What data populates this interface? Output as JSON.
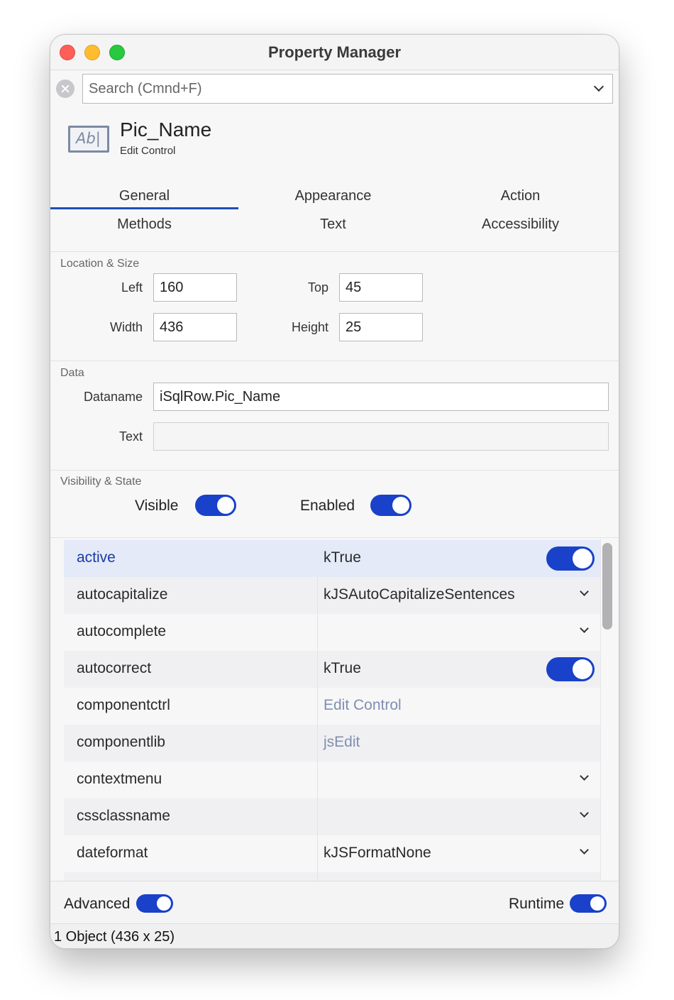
{
  "window": {
    "title": "Property Manager"
  },
  "search": {
    "placeholder": "Search (Cmnd+F)"
  },
  "object": {
    "name": "Pic_Name",
    "type": "Edit Control",
    "icon_text": "Ab|"
  },
  "tabs": [
    {
      "label": "General",
      "selected": true
    },
    {
      "label": "Appearance"
    },
    {
      "label": "Action"
    },
    {
      "label": "Methods"
    },
    {
      "label": "Text"
    },
    {
      "label": "Accessibility"
    }
  ],
  "location_size": {
    "title": "Location & Size",
    "left_label": "Left",
    "left_value": "160",
    "top_label": "Top",
    "top_value": "45",
    "width_label": "Width",
    "width_value": "436",
    "height_label": "Height",
    "height_value": "25"
  },
  "data_section": {
    "title": "Data",
    "dataname_label": "Dataname",
    "dataname_value": "iSqlRow.Pic_Name",
    "text_label": "Text",
    "text_value": ""
  },
  "visibility": {
    "title": "Visibility & State",
    "visible_label": "Visible",
    "visible_on": true,
    "enabled_label": "Enabled",
    "enabled_on": true
  },
  "properties": [
    {
      "name": "active",
      "value": "kTrue",
      "control": "toggle",
      "selected": true
    },
    {
      "name": "autocapitalize",
      "value": "kJSAutoCapitalizeSentences",
      "control": "dropdown"
    },
    {
      "name": "autocomplete",
      "value": "",
      "control": "dropdown"
    },
    {
      "name": "autocorrect",
      "value": "kTrue",
      "control": "toggle"
    },
    {
      "name": "componentctrl",
      "value": "Edit Control",
      "control": "readonly"
    },
    {
      "name": "componentlib",
      "value": "jsEdit",
      "control": "readonly"
    },
    {
      "name": "contextmenu",
      "value": "",
      "control": "dropdown"
    },
    {
      "name": "cssclassname",
      "value": "",
      "control": "dropdown"
    },
    {
      "name": "dateformat",
      "value": "kJSFormatNone",
      "control": "dropdown"
    }
  ],
  "footer": {
    "advanced_label": "Advanced",
    "advanced_on": true,
    "runtime_label": "Runtime",
    "runtime_on": true
  },
  "status": {
    "text": "1 Object (436 x 25)"
  },
  "colors": {
    "accent": "#1941c9",
    "tab_underline": "#1f4fb8",
    "readonly_value": "#7f8fb0"
  }
}
